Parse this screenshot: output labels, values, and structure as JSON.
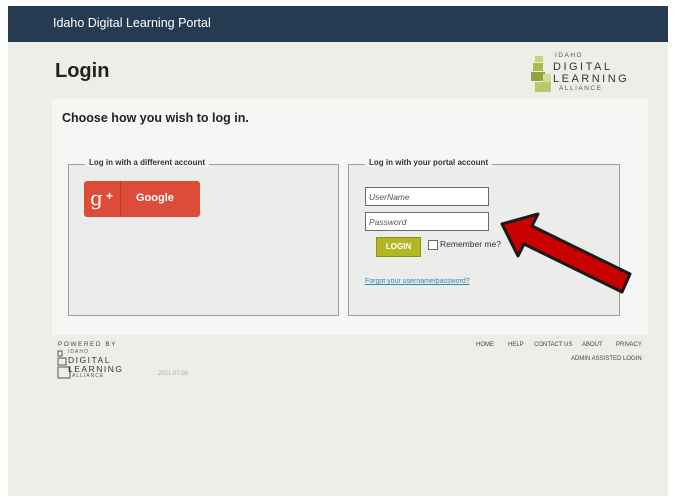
{
  "header": {
    "title": "Idaho Digital Learning Portal",
    "bg_color": "#243b52"
  },
  "page": {
    "title": "Login",
    "subtitle": "Choose how you wish to log in."
  },
  "brand_logo": {
    "line1": "IDAHO",
    "line2": "DIGITAL",
    "line3": "LEARNING",
    "line4": "ALLIANCE"
  },
  "external_login": {
    "legend": "Log in with a different account",
    "google_label": "Google",
    "google_icon": "g+",
    "google_color": "#dd4b39"
  },
  "portal_login": {
    "legend": "Log in with your portal account",
    "username_placeholder": "UserName",
    "username_value": "",
    "password_placeholder": "Password",
    "password_value": "",
    "login_label": "LOGIN",
    "login_color": "#b3b726",
    "remember_label": "Remember me?",
    "remember_checked": false,
    "forgot_link": "Forgot your username/password?"
  },
  "annotation": {
    "arrow_color": "#c80000"
  },
  "footer": {
    "powered_by": "POWERED BY",
    "logo_line1": "IDAHO",
    "logo_line2": "DIGITAL",
    "logo_line3": "LEARNING",
    "logo_line4": "ALLIANCE",
    "version": "2021.07.08",
    "nav": [
      "HOME",
      "HELP",
      "CONTACT US",
      "ABOUT",
      "PRIVACY"
    ],
    "admin_link": "ADMIN ASSISTED LOGIN"
  }
}
